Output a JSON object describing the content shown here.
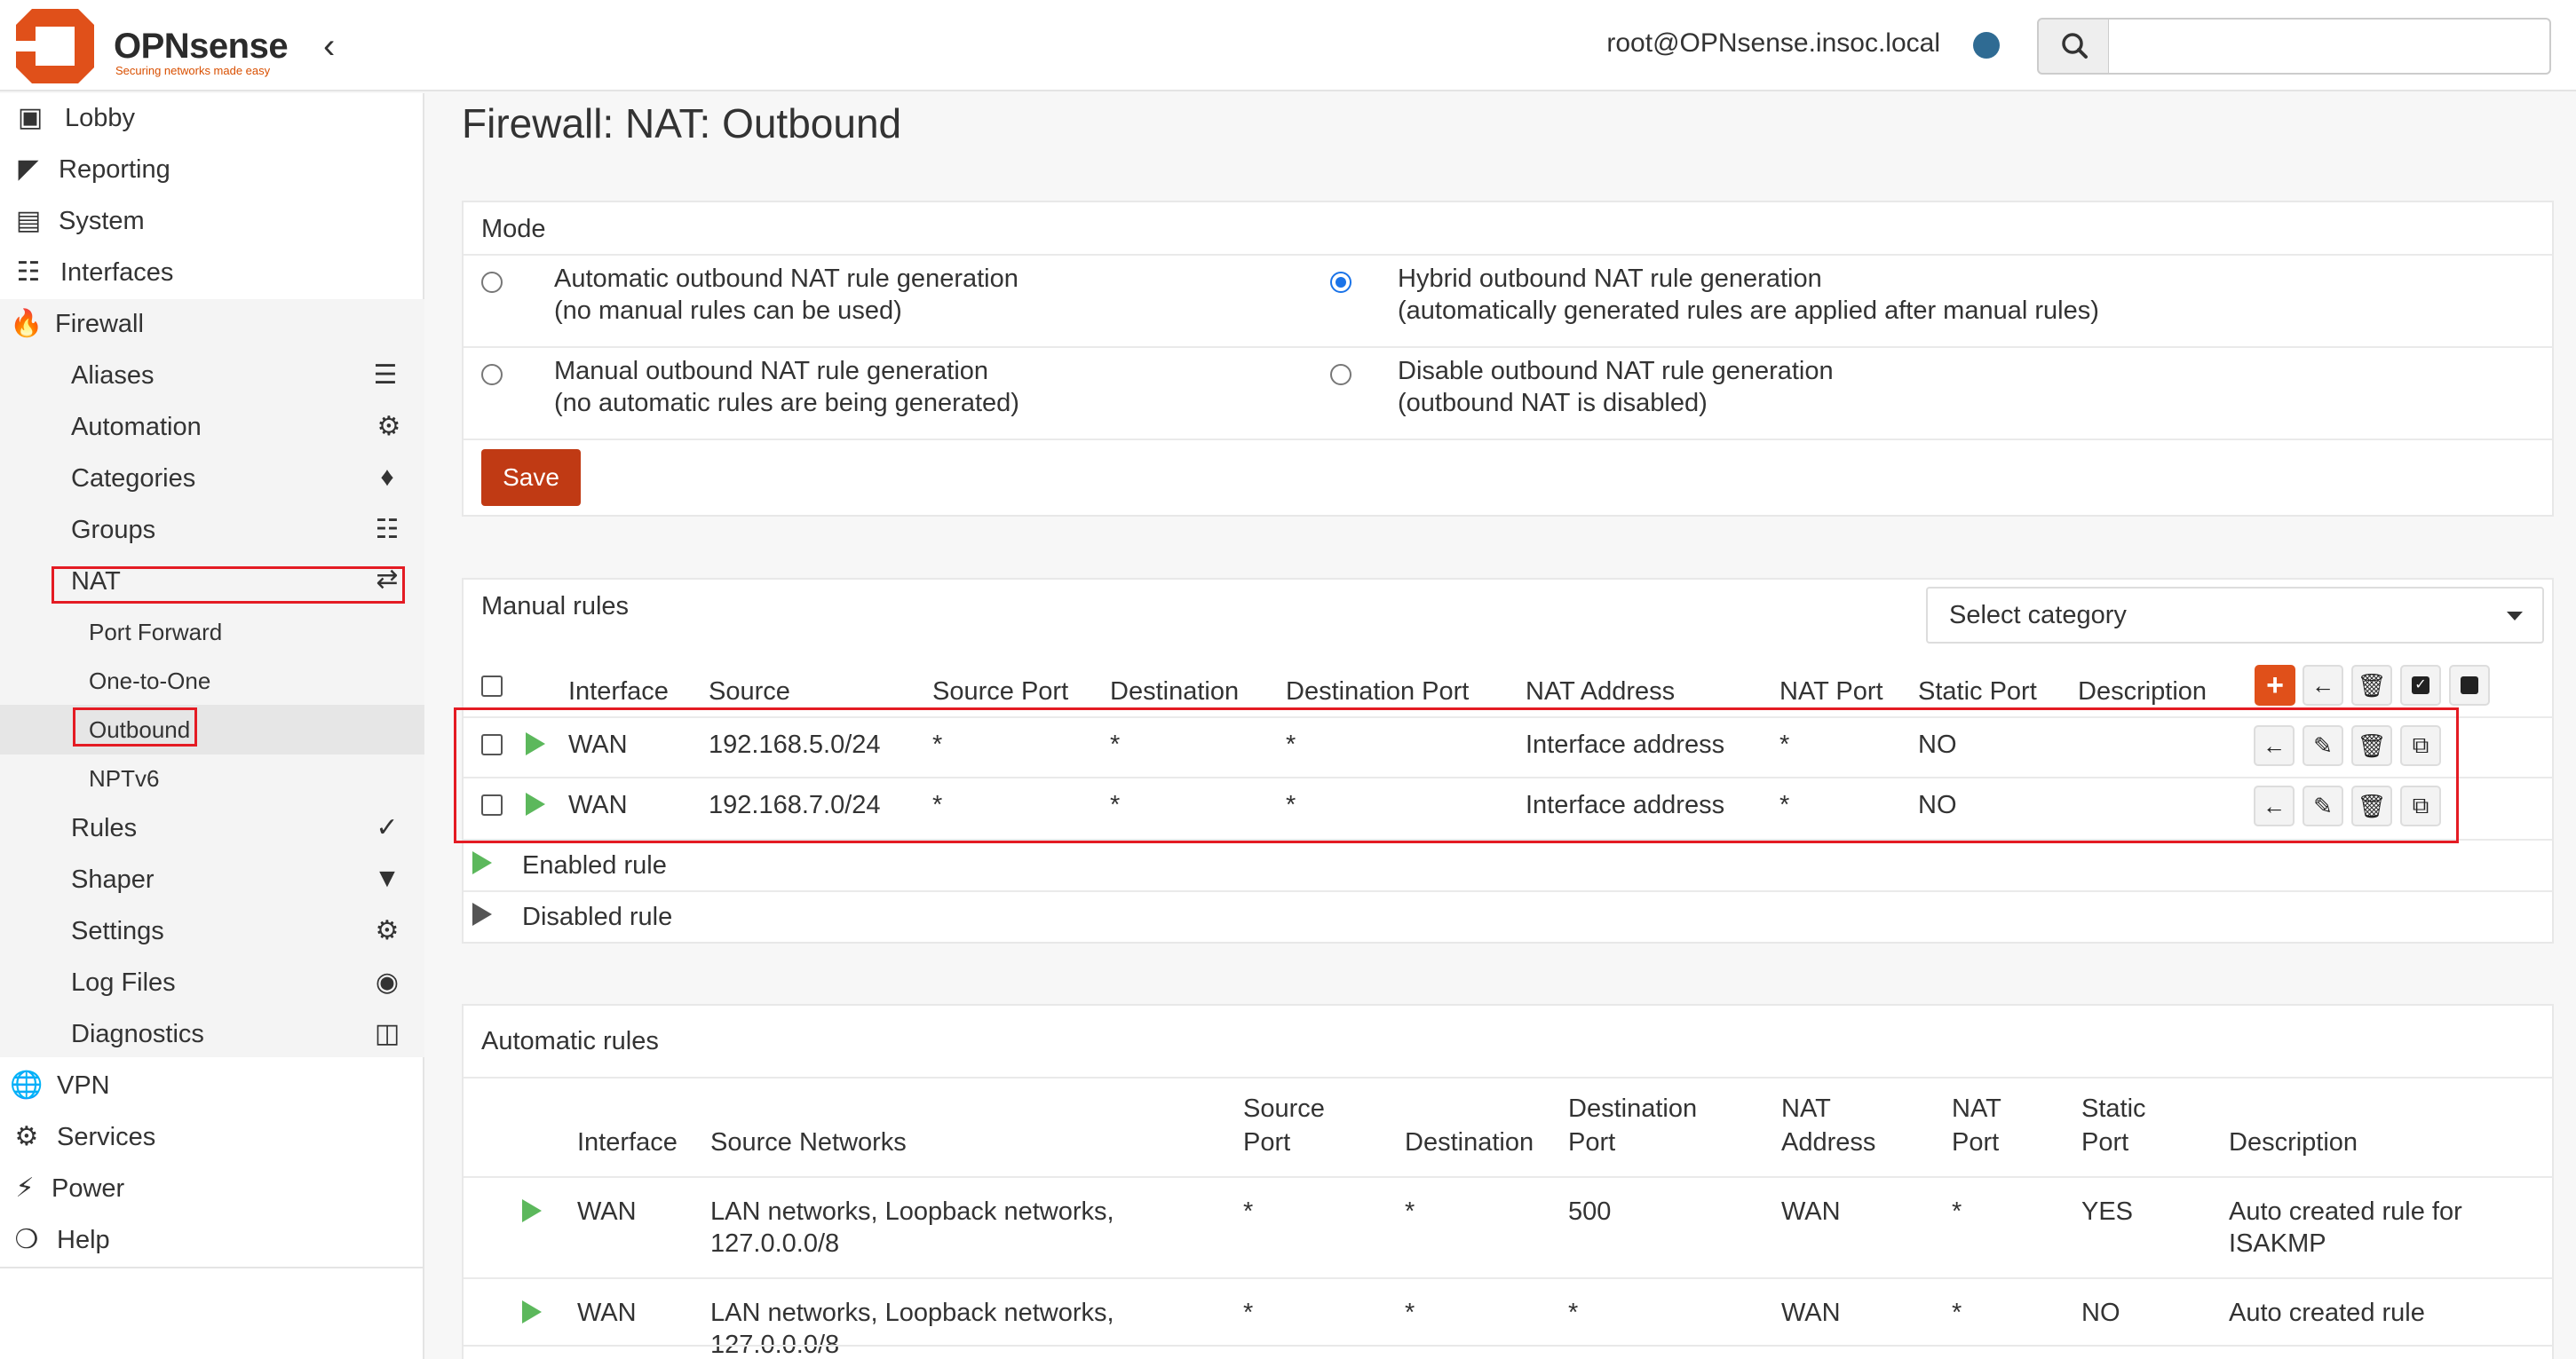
{
  "header": {
    "brand": "OPNsense",
    "tagline": "Securing networks made easy",
    "user": "root@OPNsense.insoc.local",
    "search_value": ""
  },
  "sidebar": {
    "items": [
      {
        "label": "Lobby",
        "icon": "laptop-icon"
      },
      {
        "label": "Reporting",
        "icon": "area-chart-icon"
      },
      {
        "label": "System",
        "icon": "server-icon"
      },
      {
        "label": "Interfaces",
        "icon": "sitemap-icon"
      },
      {
        "label": "Firewall",
        "icon": "fire-icon"
      },
      {
        "label": "VPN",
        "icon": "globe-icon"
      },
      {
        "label": "Services",
        "icon": "cog-icon"
      },
      {
        "label": "Power",
        "icon": "plug-icon"
      },
      {
        "label": "Help",
        "icon": "lifebuoy-icon"
      }
    ],
    "firewall_sub": [
      {
        "label": "Aliases",
        "icon": "list-icon"
      },
      {
        "label": "Automation",
        "icon": "gear-icon"
      },
      {
        "label": "Categories",
        "icon": "tags-icon"
      },
      {
        "label": "Groups",
        "icon": "sitemap-icon"
      },
      {
        "label": "NAT",
        "icon": "exchange-icon"
      },
      {
        "label": "Rules",
        "icon": "check-icon"
      },
      {
        "label": "Shaper",
        "icon": "filter-icon"
      },
      {
        "label": "Settings",
        "icon": "cogs-icon"
      },
      {
        "label": "Log Files",
        "icon": "eye-icon"
      },
      {
        "label": "Diagnostics",
        "icon": "medkit-icon"
      }
    ],
    "nat_sub": [
      "Port Forward",
      "One-to-One",
      "Outbound",
      "NPTv6"
    ]
  },
  "page": {
    "title": "Firewall: NAT: Outbound"
  },
  "mode": {
    "heading": "Mode",
    "options": [
      {
        "line1": "Automatic outbound NAT rule generation",
        "line2": "(no manual rules can be used)",
        "selected": false
      },
      {
        "line1": "Hybrid outbound NAT rule generation",
        "line2": "(automatically generated rules are applied after manual rules)",
        "selected": true
      },
      {
        "line1": "Manual outbound NAT rule generation",
        "line2": "(no automatic rules are being generated)",
        "selected": false
      },
      {
        "line1": "Disable outbound NAT rule generation",
        "line2": "(outbound NAT is disabled)",
        "selected": false
      }
    ],
    "save_label": "Save"
  },
  "manual": {
    "heading": "Manual rules",
    "category_placeholder": "Select category",
    "columns": [
      "Interface",
      "Source",
      "Source Port",
      "Destination",
      "Destination Port",
      "NAT Address",
      "NAT Port",
      "Static Port",
      "Description"
    ],
    "rows": [
      {
        "interface": "WAN",
        "source": "192.168.5.0/24",
        "source_port": "*",
        "destination": "*",
        "destination_port": "*",
        "nat_address": "Interface address",
        "nat_port": "*",
        "static_port": "NO",
        "description": ""
      },
      {
        "interface": "WAN",
        "source": "192.168.7.0/24",
        "source_port": "*",
        "destination": "*",
        "destination_port": "*",
        "nat_address": "Interface address",
        "nat_port": "*",
        "static_port": "NO",
        "description": ""
      }
    ],
    "legend": {
      "enabled": "Enabled rule",
      "disabled": "Disabled rule"
    }
  },
  "automatic": {
    "heading": "Automatic rules",
    "columns": {
      "interface": "Interface",
      "source_networks": "Source Networks",
      "source_port_1": "Source",
      "source_port_2": "Port",
      "destination": "Destination",
      "destination_port_1": "Destination",
      "destination_port_2": "Port",
      "nat_address_1": "NAT",
      "nat_address_2": "Address",
      "nat_port_1": "NAT",
      "nat_port_2": "Port",
      "static_port_1": "Static",
      "static_port_2": "Port",
      "description": "Description"
    },
    "rows": [
      {
        "interface": "WAN",
        "src1": "LAN networks, Loopback networks,",
        "src2": "127.0.0.0/8",
        "source_port": "*",
        "destination": "*",
        "destination_port": "500",
        "nat_address": "WAN",
        "nat_port": "*",
        "static_port": "YES",
        "desc1": "Auto created rule for",
        "desc2": "ISAKMP"
      },
      {
        "interface": "WAN",
        "src1": "LAN networks, Loopback networks,",
        "src2": "127.0.0.0/8",
        "source_port": "*",
        "destination": "*",
        "destination_port": "*",
        "nat_address": "WAN",
        "nat_port": "*",
        "static_port": "NO",
        "desc1": "Auto created rule",
        "desc2": ""
      }
    ]
  },
  "colors": {
    "accent": "#c03a14",
    "brand_orange": "#e0501a",
    "enabled": "#5cb85c",
    "highlight": "#e41b23"
  }
}
